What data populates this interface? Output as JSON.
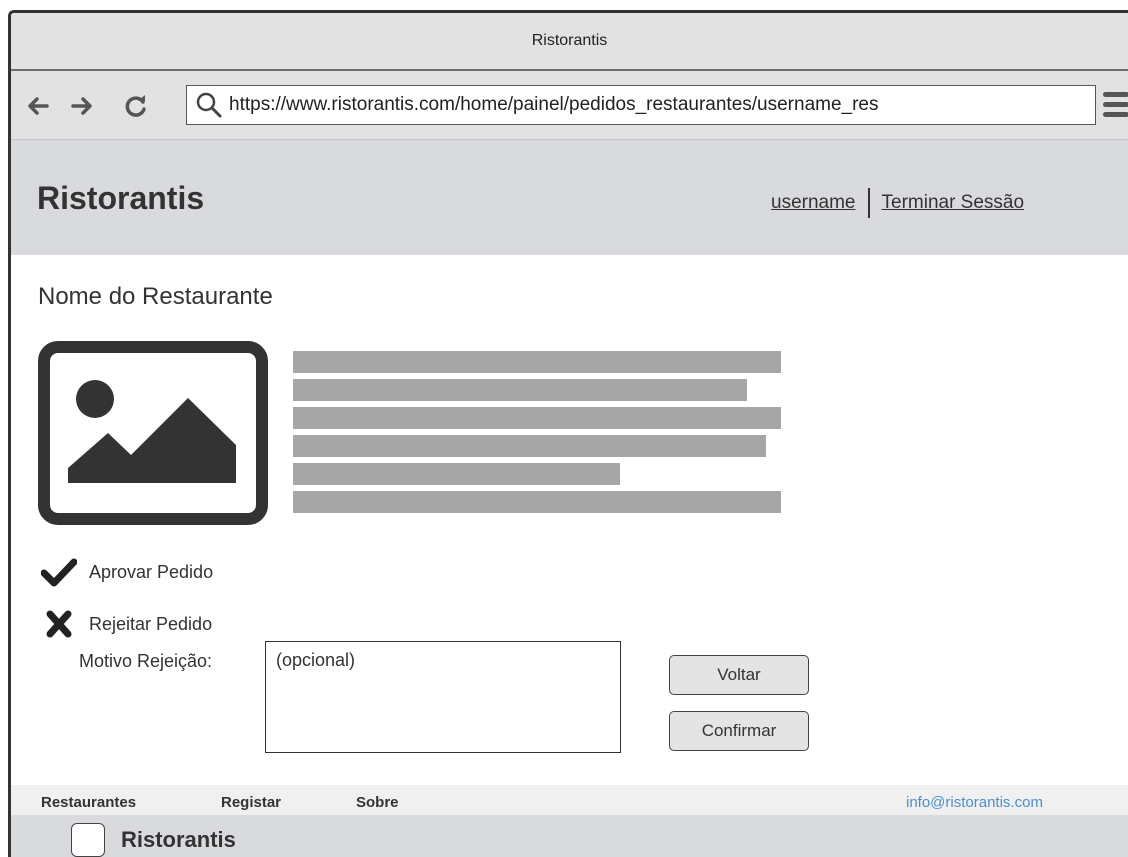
{
  "window": {
    "title": "Ristorantis"
  },
  "browser": {
    "url": "https://www.ristorantis.com/home/painel/pedidos_restaurantes/username_res",
    "icons": [
      "back-arrow-icon",
      "forward-arrow-icon",
      "reload-icon",
      "search-icon",
      "hamburger-menu-icon"
    ]
  },
  "header": {
    "brand": "Ristorantis",
    "username": "username",
    "logout": "Terminar Sessão"
  },
  "main": {
    "title": "Nome do Restaurante",
    "image_icon": "image-placeholder-icon",
    "text_placeholder_lines": [
      1,
      0.93,
      1,
      0.97,
      0.67,
      1
    ],
    "approve_label": "Aprovar Pedido",
    "reject_label": "Rejeitar Pedido",
    "reason_label": "Motivo Rejeição:",
    "reason_value": "(opcional)",
    "back_button": "Voltar",
    "confirm_button": "Confirmar"
  },
  "footer": {
    "links": [
      "Restaurantes",
      "Registar",
      "Sobre"
    ],
    "email": "info@ristorantis.com",
    "brand": "Ristorantis"
  },
  "colors": {
    "header_bg": "#d9dadd",
    "placeholder_gray": "#a6a6a6",
    "email_link": "#4a8fd1"
  }
}
